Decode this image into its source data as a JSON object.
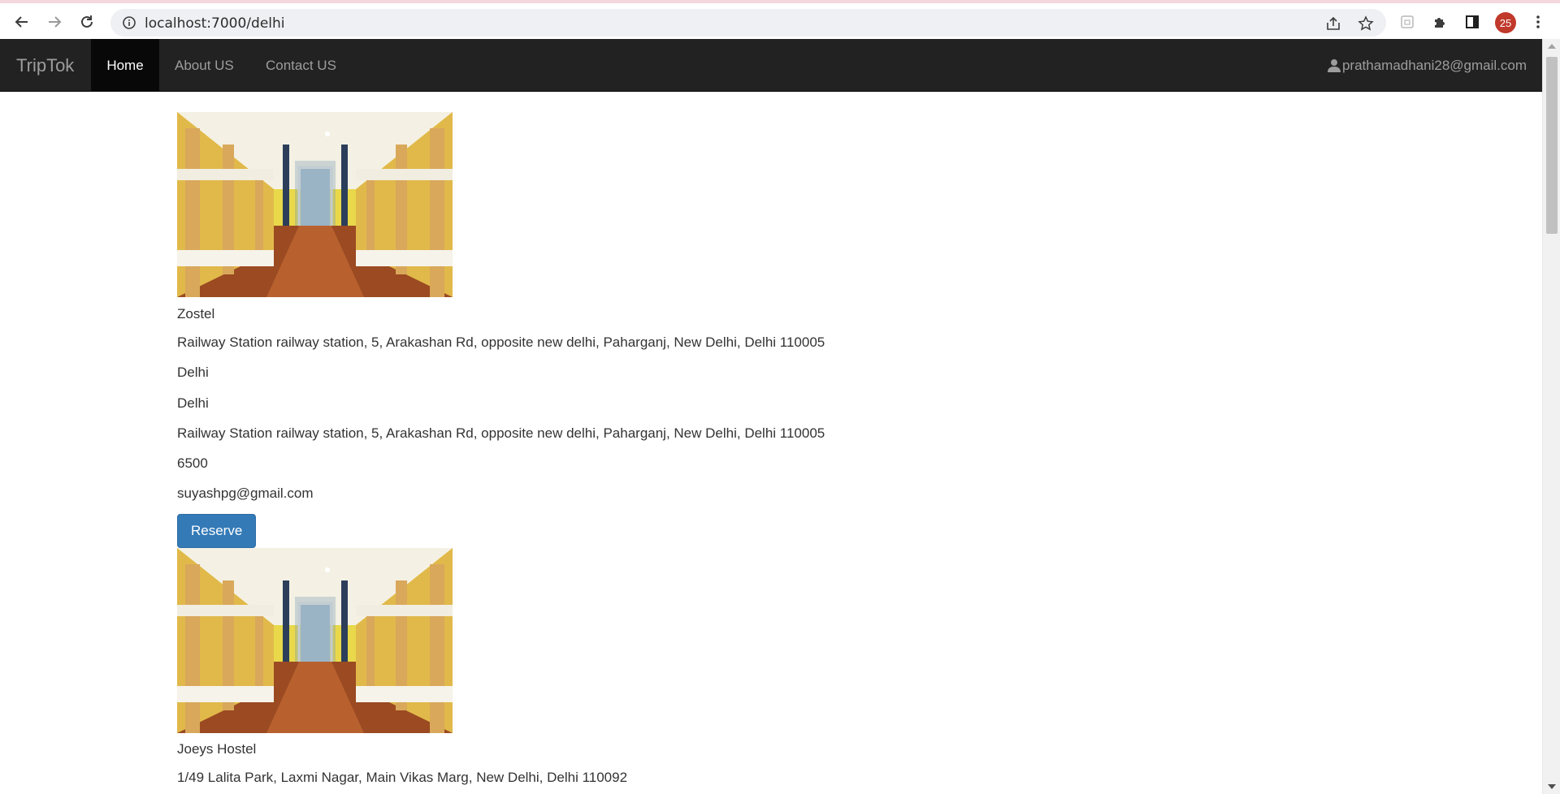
{
  "browser": {
    "url": "localhost:7000/delhi",
    "profile_badge": "25",
    "icons": [
      "back-icon",
      "forward-icon",
      "reload-icon",
      "info-icon",
      "share-icon",
      "star-icon",
      "extension-icon",
      "puzzle-icon",
      "sidepanel-icon",
      "menu-icon"
    ]
  },
  "navbar": {
    "brand": "TripTok",
    "items": [
      {
        "label": "Home",
        "active": true
      },
      {
        "label": "About US",
        "active": false
      },
      {
        "label": "Contact US",
        "active": false
      }
    ],
    "user_email": "prathamadhani28@gmail.com",
    "colors": {
      "background": "#222222",
      "active": "#080808",
      "text": "#9d9d9d"
    }
  },
  "listings": [
    {
      "name": "Zostel",
      "address": "Railway Station railway station, 5, Arakashan Rd, opposite new delhi, Paharganj, New Delhi, Delhi 110005",
      "city": "Delhi",
      "state": "Delhi",
      "address2": "Railway Station railway station, 5, Arakashan Rd, opposite new delhi, Paharganj, New Delhi, Delhi 110005",
      "price": "6500",
      "email": "suyashpg@gmail.com",
      "button": "Reserve"
    },
    {
      "name": "Joeys Hostel",
      "address": "1/49 Lalita Park, Laxmi Nagar, Main Vikas Marg, New Delhi, Delhi 110092"
    }
  ],
  "colors": {
    "reserve_button": "#337ab7"
  }
}
